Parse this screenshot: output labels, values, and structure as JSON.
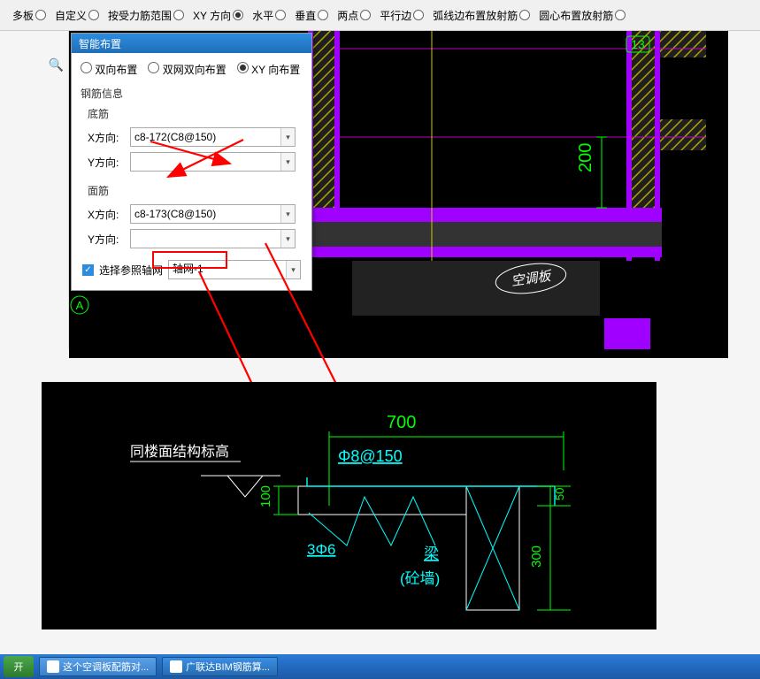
{
  "ribbon": {
    "items": [
      {
        "label": "多板",
        "checked": false
      },
      {
        "label": "自定义",
        "checked": false
      },
      {
        "label": "按受力筋范围",
        "checked": false
      },
      {
        "label": "XY 方向",
        "checked": true
      },
      {
        "label": "水平",
        "checked": false
      },
      {
        "label": "垂直",
        "checked": false
      },
      {
        "label": "两点",
        "checked": false
      },
      {
        "label": "平行边",
        "checked": false
      },
      {
        "label": "弧线边布置放射筋",
        "checked": false
      },
      {
        "label": "圆心布置放射筋",
        "checked": false
      }
    ]
  },
  "dialog": {
    "title": "智能布置",
    "radios": [
      {
        "label": "双向布置",
        "checked": false
      },
      {
        "label": "双网双向布置",
        "checked": false
      },
      {
        "label": "XY 向布置",
        "checked": true
      }
    ],
    "group_title": "钢筋信息",
    "bottom": {
      "label": "底筋",
      "x_label": "X方向:",
      "x_value": "c8-172(C8@150)",
      "y_label": "Y方向:",
      "y_value": ""
    },
    "top": {
      "label": "面筋",
      "x_label": "X方向:",
      "x_value": "c8-173(C8@150)",
      "y_label": "Y方向:",
      "y_value": ""
    },
    "ref_check_label": "选择参照轴网",
    "ref_select_value": "轴网-1"
  },
  "viewport": {
    "grid_badge": "13",
    "grid_letter": "A",
    "label_box": "空调板",
    "dim_200": "200"
  },
  "diagram": {
    "note_left": "同楼面结构标高",
    "dim_700": "700",
    "rebar_top": "Φ8@150",
    "dim_100_left": "100",
    "rebar_btm": "3Φ6",
    "beam_label": "梁",
    "wall_label": "(砼墙)",
    "dim_300": "300",
    "dim_50": "50"
  },
  "taskbar": {
    "start": "开",
    "items": [
      {
        "label": "这个空调板配筋对...",
        "active": true
      },
      {
        "label": "广联达BIM钢筋算...",
        "active": false
      }
    ]
  }
}
